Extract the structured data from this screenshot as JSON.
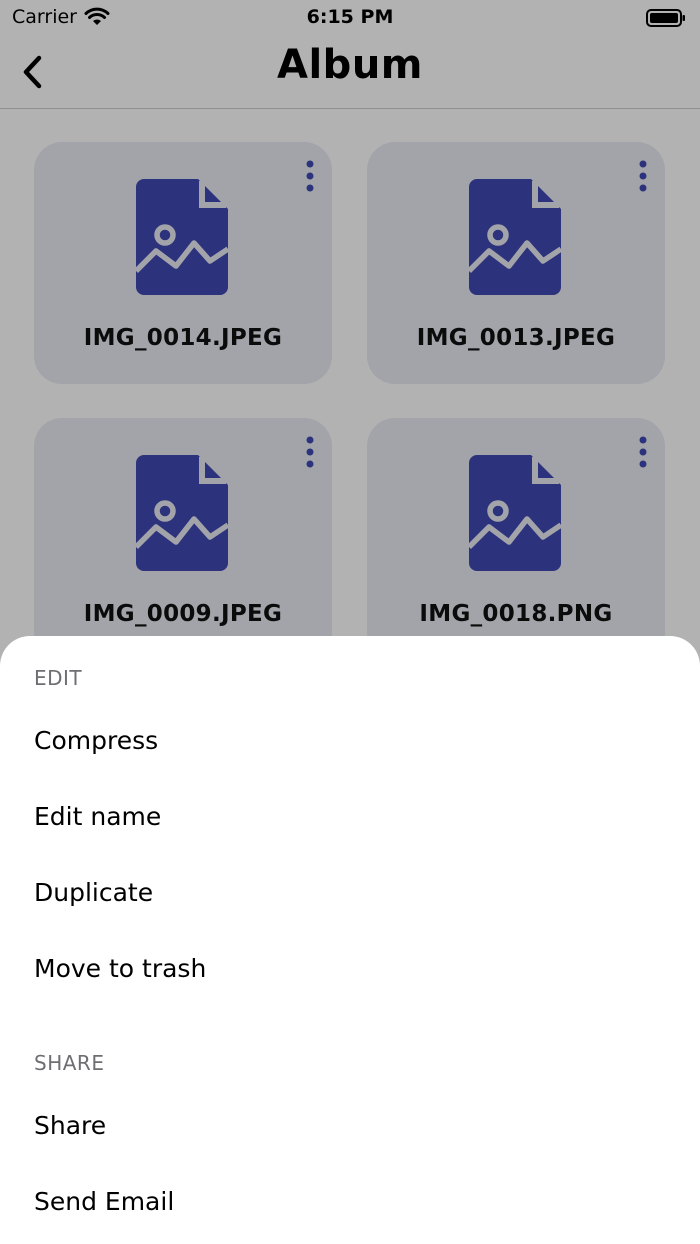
{
  "status_bar": {
    "carrier": "Carrier",
    "time": "6:15 PM"
  },
  "nav": {
    "title": "Album"
  },
  "files": [
    {
      "name": "IMG_0014.JPEG"
    },
    {
      "name": "IMG_0013.JPEG"
    },
    {
      "name": "IMG_0009.JPEG"
    },
    {
      "name": "IMG_0018.PNG"
    }
  ],
  "sheet": {
    "edit_title": "EDIT",
    "edit_items": [
      "Compress",
      "Edit name",
      "Duplicate",
      "Move to trash"
    ],
    "share_title": "SHARE",
    "share_items": [
      "Share",
      "Send Email"
    ]
  },
  "colors": {
    "accent": "#3f48b0",
    "card": "#e8ebf4",
    "scrim": "rgba(0,0,0,0.30)"
  },
  "icons": {
    "back": "chevron-left-icon",
    "file": "image-file-icon",
    "more": "more-vertical-icon",
    "wifi": "wifi-icon",
    "battery": "battery-icon"
  }
}
